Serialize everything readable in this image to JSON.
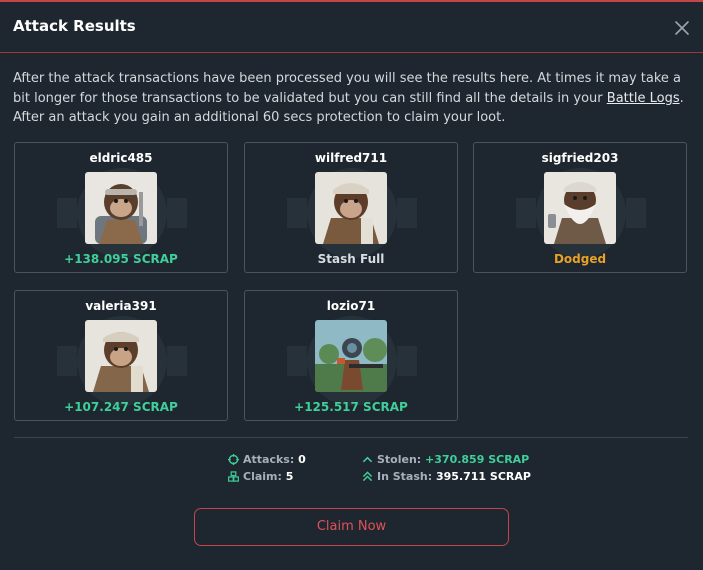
{
  "modal": {
    "title": "Attack Results",
    "intro_before": "After the attack transactions have been processed you will see the results here. At times it may take a bit longer for those transactions to be validated but you can still find all the details in your ",
    "intro_link": "Battle Logs",
    "intro_after": ". After an attack you gain an additional 60 secs protection to claim your loot."
  },
  "results": [
    {
      "name": "eldric485",
      "result": "+138.095 SCRAP",
      "status": "success",
      "status_color": "#3fcf9a"
    },
    {
      "name": "wilfred711",
      "result": "Stash Full",
      "status": "full",
      "status_color": "#d7dde3"
    },
    {
      "name": "sigfried203",
      "result": "Dodged",
      "status": "dodged",
      "status_color": "#e8a227"
    },
    {
      "name": "valeria391",
      "result": "+107.247 SCRAP",
      "status": "success",
      "status_color": "#3fcf9a"
    },
    {
      "name": "lozio71",
      "result": "+125.517 SCRAP",
      "status": "success",
      "status_color": "#3fcf9a"
    }
  ],
  "summary": {
    "attacks_label": "Attacks:",
    "attacks_value": "0",
    "claim_label": "Claim:",
    "claim_value": "5",
    "stolen_label": "Stolen:",
    "stolen_value": "+370.859 SCRAP",
    "stash_label": "In Stash:",
    "stash_value": "395.711 SCRAP"
  },
  "claim_button": "Claim Now",
  "colors": {
    "accent": "#c4454a",
    "green": "#3fcf9a",
    "orange": "#e8a227"
  }
}
